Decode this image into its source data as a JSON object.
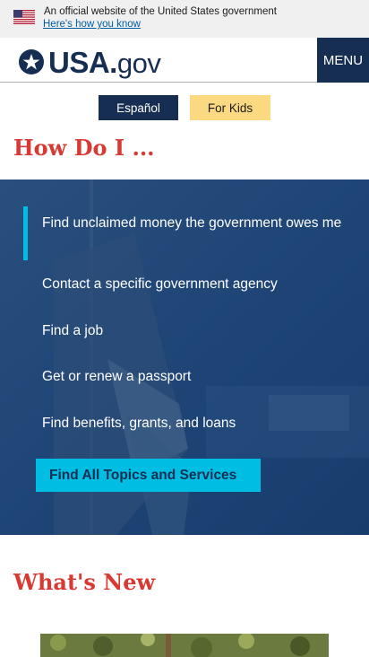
{
  "gov_banner": {
    "text": "An official website of the United States government",
    "link": "Here's how you know"
  },
  "header": {
    "logo_main": "USA.",
    "logo_suffix": "gov",
    "menu_label": "MENU"
  },
  "language": {
    "espanol": "Español",
    "kids": "For Kids"
  },
  "how_do_i": {
    "title": "How Do I ...",
    "topics": [
      "Find unclaimed money the government owes me",
      "Contact a specific government agency",
      "Find a job",
      "Get or renew a passport",
      "Find benefits, grants, and loans"
    ],
    "all_topics_button": "Find All Topics and Services"
  },
  "whats_new": {
    "title": "What's New"
  },
  "colors": {
    "navy": "#162e51",
    "red_heading": "#d83933",
    "cyan_accent": "#00bde3",
    "gold": "#fad980"
  }
}
